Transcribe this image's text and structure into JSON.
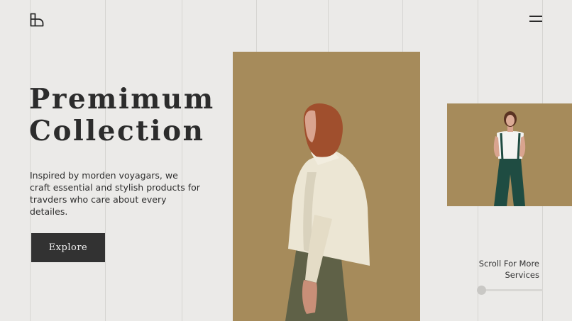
{
  "header": {
    "logo_icon": "logo-grid-icon",
    "menu_icon": "hamburger-menu-icon"
  },
  "hero": {
    "title_line1": "Premimum",
    "title_line2": "Collection",
    "description": "Inspired by morden voyagars, we craft essential and stylish products for travders who care about every detailes.",
    "cta_label": "Explore"
  },
  "images": {
    "main_bg": "#a68b5b",
    "side_bg": "#a68b5b"
  },
  "scroll": {
    "line1": "Scroll For More",
    "line2": "Services",
    "progress": 0
  },
  "colors": {
    "background": "#ebeae8",
    "text": "#2b2b2b",
    "button_bg": "#323232",
    "accent_tan": "#a68b5b"
  }
}
